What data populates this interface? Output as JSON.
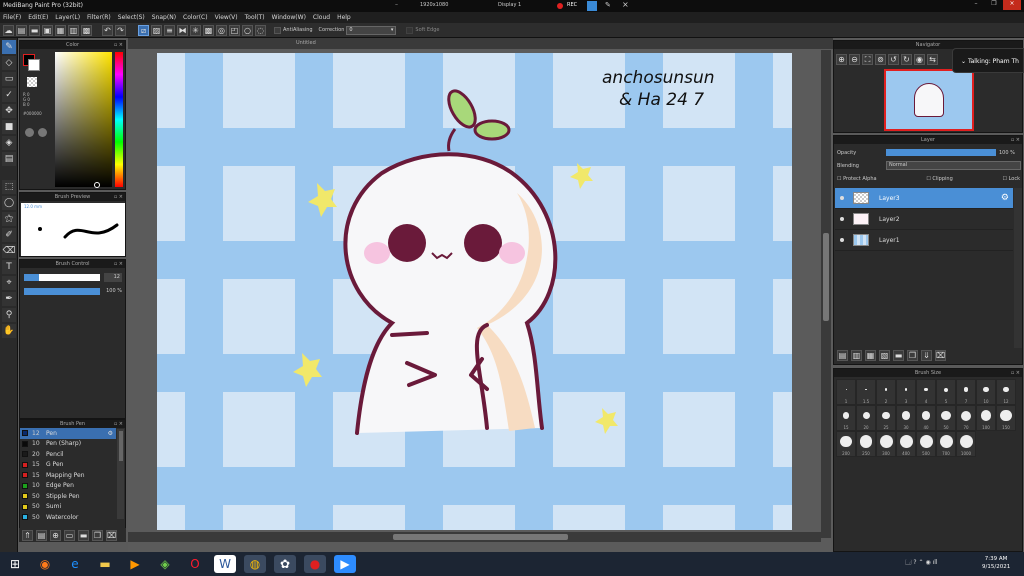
{
  "app": {
    "title": "MediBang Paint Pro (32bit)",
    "resolution": "1920x1080",
    "display": "Display 1",
    "rec": "REC"
  },
  "menu": [
    "File(F)",
    "Edit(E)",
    "Layer(L)",
    "Filter(R)",
    "Select(S)",
    "Snap(N)",
    "Color(C)",
    "View(V)",
    "Tool(T)",
    "Window(W)",
    "Cloud",
    "Help"
  ],
  "toolbar": {
    "antialias": "AntiAliasing",
    "correction_label": "Correction",
    "correction_value": "0",
    "soft_edge": "Soft Edge"
  },
  "color_panel": {
    "title": "Color",
    "r": "R 0",
    "g": "G 0",
    "b": "B 0",
    "hex": "#000000"
  },
  "brush_preview": {
    "title": "Brush Preview",
    "size": "12.0 mm"
  },
  "brush_control": {
    "title": "Brush Control",
    "size": "12",
    "opacity": "100 %"
  },
  "brush_panel": {
    "title": "Brush Pen",
    "items": [
      {
        "size": "12",
        "name": "Pen",
        "color": "#0a2a6a",
        "selected": true
      },
      {
        "size": "10",
        "name": "Pen (Sharp)",
        "color": "#0a0a0a"
      },
      {
        "size": "20",
        "name": "Pencil",
        "color": "#1a1a1a"
      },
      {
        "size": "15",
        "name": "G Pen",
        "color": "#d42020"
      },
      {
        "size": "15",
        "name": "Mapping Pen",
        "color": "#d42020"
      },
      {
        "size": "10",
        "name": "Edge Pen",
        "color": "#1ca01c"
      },
      {
        "size": "50",
        "name": "Stipple Pen",
        "color": "#e0c81a"
      },
      {
        "size": "50",
        "name": "Sumi",
        "color": "#e0c81a"
      },
      {
        "size": "50",
        "name": "Watercolor",
        "color": "#2ab0e0"
      }
    ]
  },
  "document": {
    "title": "Untitled",
    "watermark_line1": "anchosunsun",
    "watermark_line2": "& Ha 24 7"
  },
  "navigator": {
    "title": "Navigator"
  },
  "notification": {
    "text": "Talking: Pham Th"
  },
  "layer_panel": {
    "title": "Layer",
    "opacity_label": "Opacity",
    "opacity_value": "100 %",
    "opacity_fraction": 1.0,
    "blending_label": "Blending",
    "blending_value": "Normal",
    "protect_alpha": "Protect Alpha",
    "clipping": "Clipping",
    "lock": "Lock",
    "layers": [
      {
        "name": "Layer3",
        "selected": true
      },
      {
        "name": "Layer2"
      },
      {
        "name": "Layer1"
      }
    ]
  },
  "brush_size": {
    "title": "Brush Size",
    "labels": [
      "1",
      "1.5",
      "2",
      "3",
      "4",
      "5",
      "7",
      "10",
      "12",
      "15",
      "20",
      "25",
      "30",
      "40",
      "50",
      "70",
      "100",
      "150",
      "200",
      "250",
      "300",
      "400",
      "500",
      "700",
      "1000"
    ]
  },
  "taskbar": {
    "time": "7:39 AM",
    "date": "9/15/2021"
  },
  "colors": {
    "canvas_bg": "#d2e4f5",
    "grid_blue": "#9cc8ef",
    "outline": "#6a1a3a",
    "body": "#f7f7f9",
    "shade": "#f7dcc2",
    "star": "#f1e86a",
    "leaf": "#a8d87a",
    "blush": "#f6c4e0",
    "eye": "#6a1a3a"
  }
}
